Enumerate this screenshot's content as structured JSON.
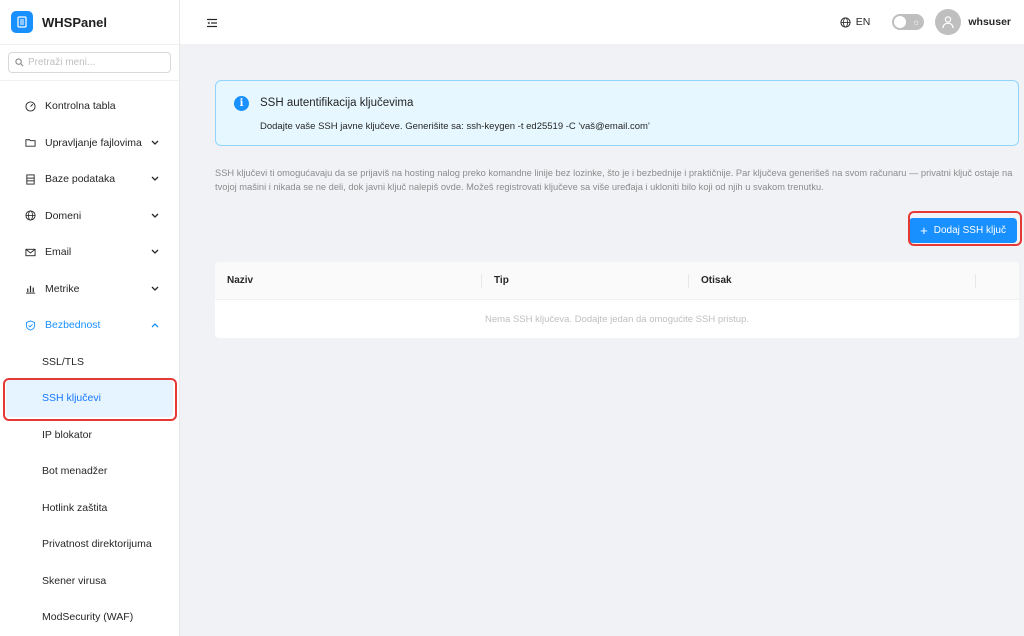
{
  "brand": {
    "name": "WHSPanel"
  },
  "search": {
    "placeholder": "Pretraži meni..."
  },
  "menu": {
    "items": [
      {
        "label": "Kontrolna tabla",
        "icon": "dashboard-icon",
        "has_children": false
      },
      {
        "label": "Upravljanje fajlovima",
        "icon": "folder-icon",
        "has_children": true
      },
      {
        "label": "Baze podataka",
        "icon": "database-icon",
        "has_children": true
      },
      {
        "label": "Domeni",
        "icon": "globe-icon",
        "has_children": true
      },
      {
        "label": "Email",
        "icon": "mail-icon",
        "has_children": true
      },
      {
        "label": "Metrike",
        "icon": "chart-icon",
        "has_children": true
      },
      {
        "label": "Bezbednost",
        "icon": "shield-icon",
        "has_children": true,
        "expanded": true
      }
    ],
    "security_children": [
      {
        "label": "SSL/TLS"
      },
      {
        "label": "SSH ključevi",
        "selected": true
      },
      {
        "label": "IP blokator"
      },
      {
        "label": "Bot menadžer"
      },
      {
        "label": "Hotlink zaštita"
      },
      {
        "label": "Privatnost direktorijuma"
      },
      {
        "label": "Skener virusa"
      },
      {
        "label": "ModSecurity (WAF)"
      }
    ]
  },
  "header": {
    "language": "EN",
    "theme_toggle_icon": "☼",
    "username": "whsuser"
  },
  "alert": {
    "title": "SSH autentifikacija ključevima",
    "description": "Dodajte vaše SSH javne ključeve. Generišite sa: ssh-keygen -t ed25519 -C 'vaš@email.com'"
  },
  "page": {
    "description": "SSH ključevi ti omogućavaju da se prijaviš na hosting nalog preko komandne linije bez lozinke, što je i bezbednije i praktičnije. Par ključeva generišeš na svom računaru — privatni ključ ostaje na tvojoj mašini i nikada se ne deli, dok javni ključ nalepiš ovde. Možeš registrovati ključeve sa više uređaja i ukloniti bilo koji od njih u svakom trenutku.",
    "add_button": "Dodaj SSH ključ",
    "add_button_icon": "+"
  },
  "table": {
    "columns": [
      "Naziv",
      "Tip",
      "Otisak",
      ""
    ],
    "empty_text": "Nema SSH ključeva. Dodajte jedan da omogućite SSH pristup."
  },
  "colors": {
    "primary": "#1890ff",
    "highlight": "#e53935",
    "alert_bg": "#e6f7ff"
  }
}
